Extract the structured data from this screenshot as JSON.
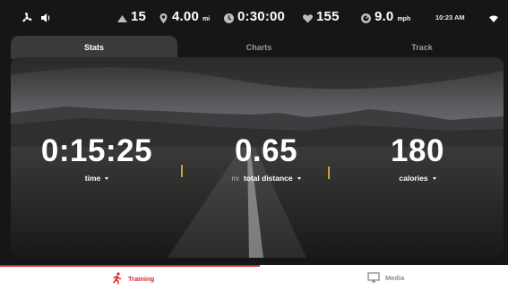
{
  "status_bar": {
    "incline": "15",
    "distance": "4.00",
    "distance_unit": "mi",
    "elapsed": "0:30:00",
    "heart_rate": "155",
    "speed": "9.0",
    "speed_unit": "mph",
    "clock": "10:23 AM",
    "icons": [
      "fan-icon",
      "volume-icon",
      "incline-icon",
      "location-pin-icon",
      "clock-icon",
      "heart-icon",
      "speed-icon",
      "wifi-icon"
    ]
  },
  "tabs": [
    {
      "label": "Stats",
      "active": true
    },
    {
      "label": "Charts",
      "active": false
    },
    {
      "label": "Track",
      "active": false
    }
  ],
  "stats": {
    "time": {
      "value": "0:15:25",
      "label": "time"
    },
    "distance": {
      "value": "0.65",
      "unit": "mi",
      "label": "total distance"
    },
    "calories": {
      "value": "180",
      "label": "calories"
    }
  },
  "bottom_nav": {
    "training": "Training",
    "media": "Media"
  },
  "colors": {
    "accent": "#d9262b",
    "active_tab": "#3a3a3a",
    "background": "#161616"
  }
}
